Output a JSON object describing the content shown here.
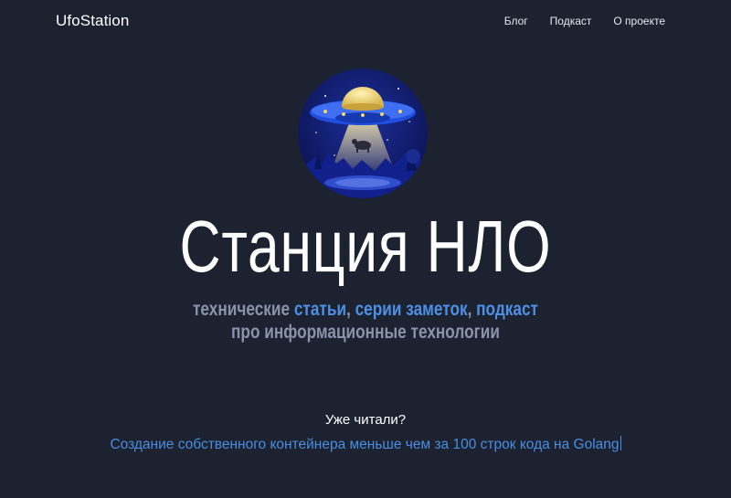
{
  "header": {
    "brand": "UfoStation",
    "nav": [
      {
        "label": "Блог"
      },
      {
        "label": "Подкаст"
      },
      {
        "label": "О проекте"
      }
    ]
  },
  "hero": {
    "title": "Станция НЛО",
    "subtitle": {
      "prefix": "технические ",
      "link_articles": "статьи",
      "sep1": ", ",
      "link_series": "серии заметок",
      "sep2": ", ",
      "link_podcast": "подкаст",
      "line2": "про информационные технологии"
    }
  },
  "recent": {
    "label": "Уже читали?",
    "article_title": "Создание собственного контейнера меньше чем за 100 строк кода на Golang"
  },
  "colors": {
    "background": "#1c2230",
    "accent": "#4a8de0",
    "muted": "#8a93a8"
  },
  "icons": {
    "logo": "ufo-logo-icon"
  }
}
